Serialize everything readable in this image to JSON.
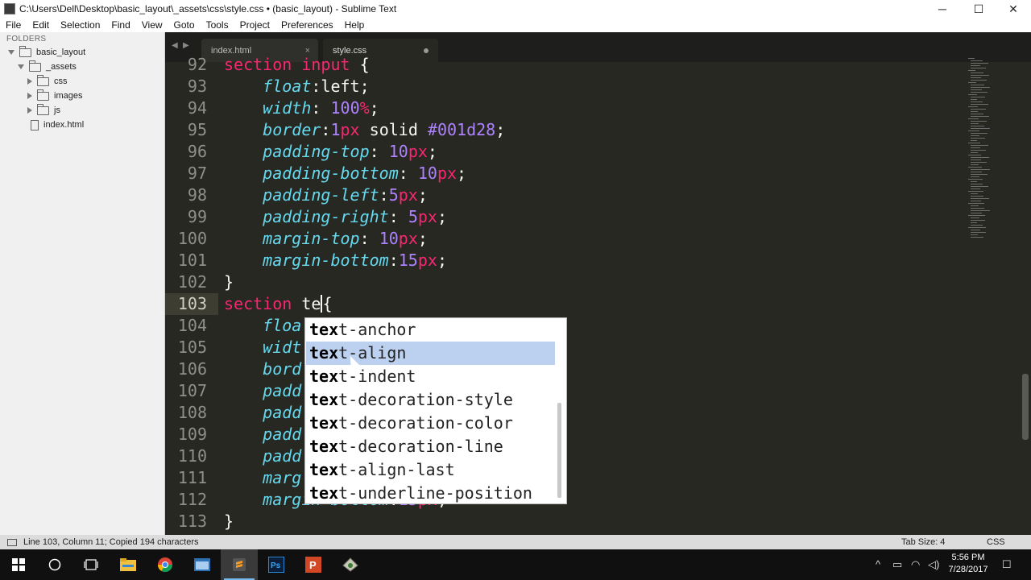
{
  "window": {
    "title": "C:\\Users\\Dell\\Desktop\\basic_layout\\_assets\\css\\style.css • (basic_layout) - Sublime Text",
    "minimize": "─",
    "maximize": "☐",
    "close": "✕"
  },
  "menu": [
    "File",
    "Edit",
    "Selection",
    "Find",
    "View",
    "Goto",
    "Tools",
    "Project",
    "Preferences",
    "Help"
  ],
  "sidebar": {
    "header": "FOLDERS",
    "root": "basic_layout",
    "assets": "_assets",
    "folders": [
      "css",
      "images",
      "js"
    ],
    "file": "index.html"
  },
  "tabs": [
    {
      "label": "index.html",
      "close": "×"
    },
    {
      "label": "style.css"
    }
  ],
  "nav": {
    "back": "◀",
    "forward": "▶"
  },
  "editor": {
    "lines": [
      {
        "n": "92",
        "t": "section input {"
      },
      {
        "n": "93",
        "t": "    float:left;"
      },
      {
        "n": "94",
        "t": "    width: 100%;"
      },
      {
        "n": "95",
        "t": "    border:1px solid #001d28;"
      },
      {
        "n": "96",
        "t": "    padding-top: 10px;"
      },
      {
        "n": "97",
        "t": "    padding-bottom: 10px;"
      },
      {
        "n": "98",
        "t": "    padding-left:5px;"
      },
      {
        "n": "99",
        "t": "    padding-right: 5px;"
      },
      {
        "n": "100",
        "t": "    margin-top: 10px;"
      },
      {
        "n": "101",
        "t": "    margin-bottom:15px;"
      },
      {
        "n": "102",
        "t": "}"
      },
      {
        "n": "103",
        "t": "section te{"
      },
      {
        "n": "104",
        "t": "    floa"
      },
      {
        "n": "105",
        "t": "    widt"
      },
      {
        "n": "106",
        "t": "    bord"
      },
      {
        "n": "107",
        "t": "    padd"
      },
      {
        "n": "108",
        "t": "    padd"
      },
      {
        "n": "109",
        "t": "    padd"
      },
      {
        "n": "110",
        "t": "    padd"
      },
      {
        "n": "111",
        "t": "    marg"
      },
      {
        "n": "112",
        "t": "    margin-bottom:15px;"
      },
      {
        "n": "113",
        "t": "}"
      }
    ]
  },
  "autocomplete": {
    "typed": "tex",
    "items": [
      "text-anchor",
      "text-align",
      "text-indent",
      "text-decoration-style",
      "text-decoration-color",
      "text-decoration-line",
      "text-align-last",
      "text-underline-position"
    ],
    "selected": "text-align"
  },
  "status": {
    "text": "Line 103, Column 11; Copied 194 characters",
    "tab_size": "Tab Size: 4",
    "syntax": "CSS"
  },
  "taskbar": {
    "time": "5:56 PM",
    "date": "7/28/2017",
    "apps": [
      "start-icon",
      "cortana-icon",
      "task-view-icon",
      "file-explorer-icon",
      "chrome-icon",
      "app-window-icon",
      "sublime-text-icon",
      "photoshop-icon",
      "powerpoint-icon",
      "tool-icon"
    ]
  }
}
